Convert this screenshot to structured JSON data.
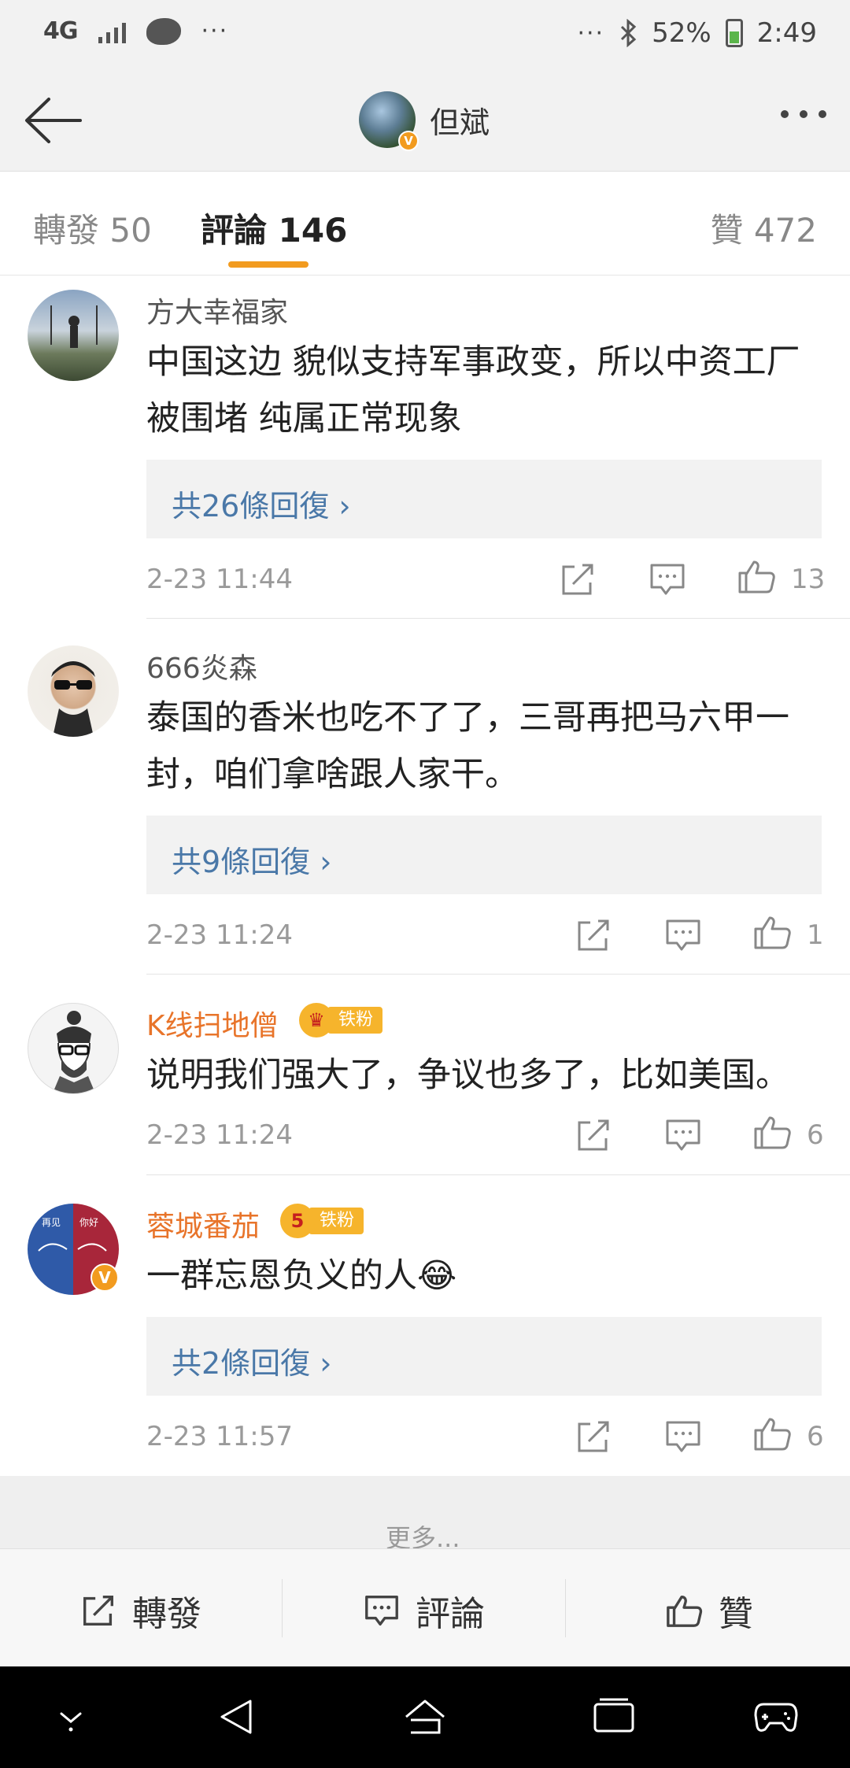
{
  "status_bar": {
    "network": "4G",
    "dots_left": "···",
    "dots_right": "···",
    "battery": "52%",
    "time": "2:49",
    "icons": [
      "signal-icon",
      "app-notification-icon",
      "bluetooth-icon",
      "battery-icon"
    ]
  },
  "nav": {
    "title": "但斌",
    "verified_mark": "V"
  },
  "tabs": {
    "repost": "轉發 50",
    "comments": "評論 146",
    "likes": "贊 472"
  },
  "comments": [
    {
      "user": "方大幸福家",
      "text": "中国这边 貌似支持军事政变，所以中资工厂被围堵 纯属正常现象",
      "replies": "共26條回復 ›",
      "time": "2-23 11:44",
      "likes": "13"
    },
    {
      "user": "666炎森",
      "text": "泰国的香米也吃不了了，三哥再把马六甲一封，咱们拿啥跟人家干。",
      "replies": "共9條回復 ›",
      "time": "2-23 11:24",
      "likes": "1"
    },
    {
      "user": "K线扫地僧",
      "fan_badge": "铁粉",
      "text": "说明我们强大了，争议也多了，比如美国。",
      "time": "2-23 11:24",
      "likes": "6"
    },
    {
      "user": "蓉城番茄",
      "fan_badge": "铁粉",
      "fan_level": "5",
      "text": "一群忘恩负义的人😂",
      "replies": "共2條回復 ›",
      "time": "2-23 11:57",
      "likes": "6"
    }
  ],
  "more": "更多...",
  "bottom_bar": {
    "repost": "轉發",
    "comment": "評論",
    "like": "贊"
  },
  "colors": {
    "accent": "#f29b1f",
    "link": "#4a78a8",
    "vip_name": "#e8742a"
  }
}
